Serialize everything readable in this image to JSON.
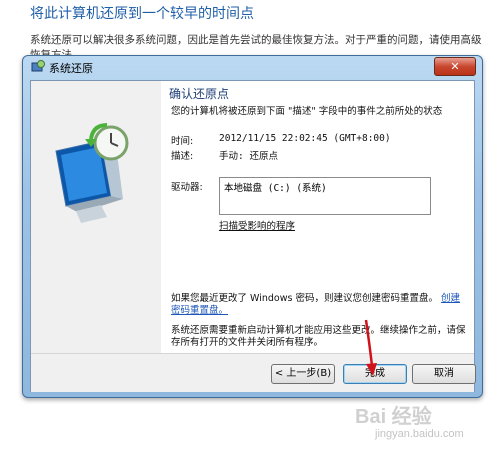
{
  "page": {
    "title": "将此计算机还原到一个较早的时间点",
    "description": "系统还原可以解决很多系统问题，因此是首先尝试的最佳恢复方法。对于严重的问题，请使用高级恢复方法。"
  },
  "window": {
    "title": "系统还原",
    "close_label": "✕",
    "heading": "确认还原点",
    "subtext": "您的计算机将被还原到下面 \"描述\" 字段中的事件之前所处的状态",
    "time_label": "时间:",
    "time_value": "2012/11/15 22:02:45 (GMT+8:00)",
    "desc_label": "描述:",
    "desc_value": "手动: 还原点",
    "drives_label": "驱动器:",
    "drives_value": "本地磁盘 (C:) (系统)",
    "scan_link": "扫描受影响的程序",
    "password_text": "如果您最近更改了 Windows 密码，则建议您创建密码重置盘。",
    "password_link": "创建密码重置盘。",
    "restart_text": "系统还原需要重新启动计算机才能应用这些更改。继续操作之前，请保存所有打开的文件并关闭所有程序。",
    "buttons": {
      "back": "< 上一步(B)",
      "finish": "完成",
      "cancel": "取消"
    }
  },
  "watermark": {
    "main": "Bai 经验",
    "sub": "jingyan.baidu.com"
  },
  "colors": {
    "accent": "#1f5fa8",
    "link": "#1c56b8",
    "arrow": "#d0121b"
  }
}
